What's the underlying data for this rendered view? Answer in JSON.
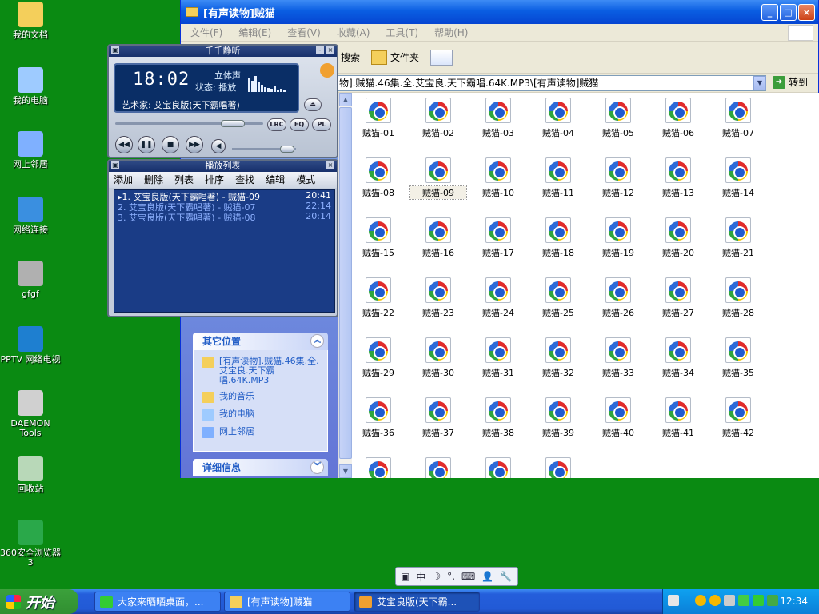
{
  "desktop": {
    "icons": [
      {
        "label": "我的文档",
        "icon": "my-documents-icon"
      },
      {
        "label": "我的电脑",
        "icon": "my-computer-icon"
      },
      {
        "label": "网上邻居",
        "icon": "network-places-icon"
      },
      {
        "label": "网络连接",
        "icon": "network-connections-icon"
      },
      {
        "label": "gfgf",
        "icon": "shortcut-icon"
      },
      {
        "label": "PPTV 网络电视",
        "icon": "pptv-icon"
      },
      {
        "label": "DAEMON Tools",
        "icon": "daemon-tools-icon"
      },
      {
        "label": "回收站",
        "icon": "recycle-bin-icon"
      },
      {
        "label": "360安全浏览器 3",
        "icon": "browser-360-icon"
      }
    ]
  },
  "explorer": {
    "title": "[有声读物]贼猫",
    "menu": [
      "文件(F)",
      "编辑(E)",
      "查看(V)",
      "收藏(A)",
      "工具(T)",
      "帮助(H)"
    ],
    "toolbar": {
      "search": "搜索",
      "folders": "文件夹"
    },
    "address": "物].贼猫.46集.全.艾宝良.天下霸唱.64K.MP3\\[有声读物]贼猫",
    "go_label": "转到",
    "other_places": {
      "title": "其它位置",
      "links": [
        {
          "label": "[有声读物].贼猫.46集.全.艾宝良.天下霸唱.64K.MP3",
          "icon": "folder-icon"
        },
        {
          "label": "我的音乐",
          "icon": "music-folder-icon"
        },
        {
          "label": "我的电脑",
          "icon": "my-computer-icon"
        },
        {
          "label": "网上邻居",
          "icon": "network-places-icon"
        }
      ]
    },
    "details": {
      "title": "详细信息"
    },
    "files": [
      "贼猫-01",
      "贼猫-02",
      "贼猫-03",
      "贼猫-04",
      "贼猫-05",
      "贼猫-06",
      "贼猫-07",
      "贼猫-08",
      "贼猫-09",
      "贼猫-10",
      "贼猫-11",
      "贼猫-12",
      "贼猫-13",
      "贼猫-14",
      "贼猫-15",
      "贼猫-16",
      "贼猫-17",
      "贼猫-18",
      "贼猫-19",
      "贼猫-20",
      "贼猫-21",
      "贼猫-22",
      "贼猫-23",
      "贼猫-24",
      "贼猫-25",
      "贼猫-26",
      "贼猫-27",
      "贼猫-28",
      "贼猫-29",
      "贼猫-30",
      "贼猫-31",
      "贼猫-32",
      "贼猫-33",
      "贼猫-34",
      "贼猫-35",
      "贼猫-36",
      "贼猫-37",
      "贼猫-38",
      "贼猫-39",
      "贼猫-40",
      "贼猫-41",
      "贼猫-42",
      "",
      "",
      "",
      ""
    ],
    "selected_file": "贼猫-09"
  },
  "player": {
    "title": "千千静听",
    "time": "18:02",
    "stereo": "立体声",
    "state": "状态: 播放",
    "artist": "艺术家: 艾宝良版(天下霸唱著)",
    "buttons": {
      "lrc": "LRC",
      "eq": "EQ",
      "pl": "PL"
    }
  },
  "playlist": {
    "title": "播放列表",
    "menu": [
      "添加",
      "删除",
      "列表",
      "排序",
      "查找",
      "编辑",
      "模式"
    ],
    "items": [
      {
        "name": "▸1. 艾宝良版(天下霸唱著) - 贼猫-09",
        "duration": "20:41",
        "color": "#ffffff"
      },
      {
        "name": "2. 艾宝良版(天下霸唱著) - 贼猫-07",
        "duration": "22:14",
        "color": "#8eb1ff"
      },
      {
        "name": "3. 艾宝良版(天下霸唱著) - 贼猫-08",
        "duration": "20:14",
        "color": "#8eb1ff"
      }
    ]
  },
  "taskbar": {
    "start": "开始",
    "tasks": [
      {
        "label": "大家来晒晒桌面，...",
        "icon": "browser-360-icon"
      },
      {
        "label": "[有声读物]贼猫",
        "icon": "folder-icon"
      },
      {
        "label": "艾宝良版(天下霸...",
        "icon": "ttplayer-icon"
      }
    ],
    "clock": "12:34"
  },
  "ime": {
    "mode": "中"
  }
}
